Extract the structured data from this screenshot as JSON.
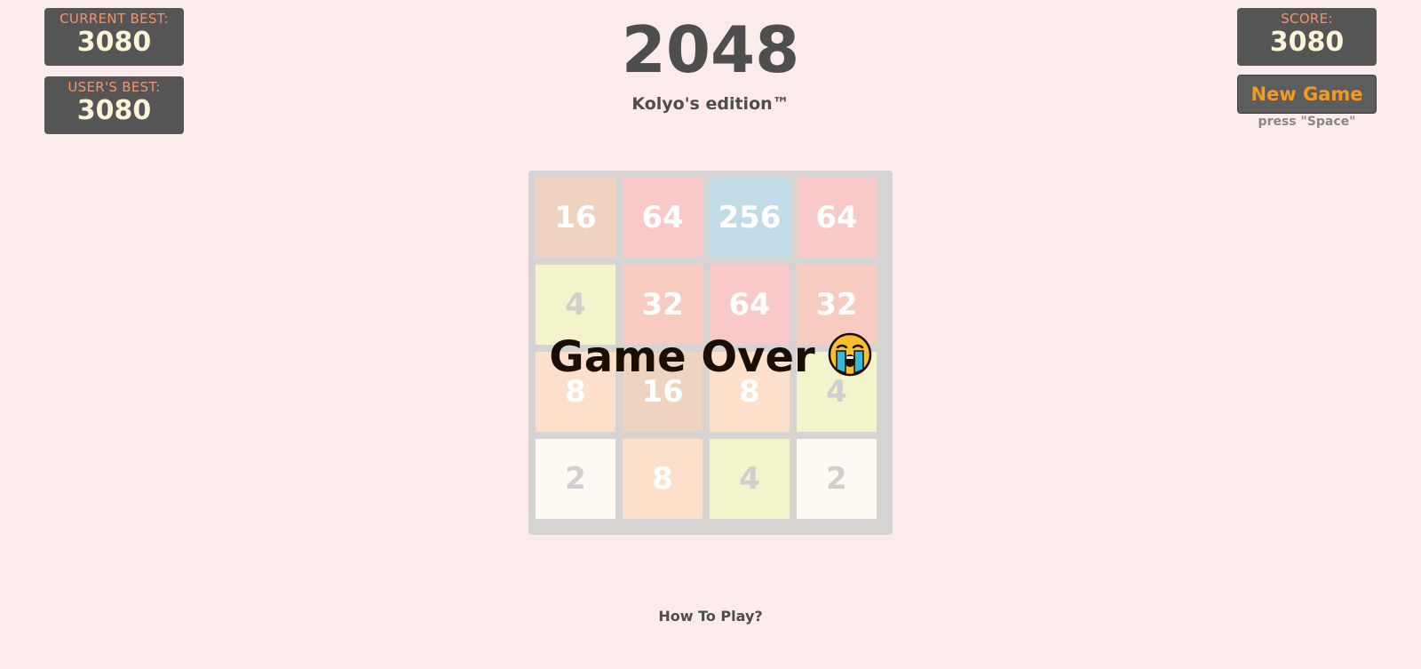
{
  "stats": {
    "current_best": {
      "label": "CURRENT BEST:",
      "value": "3080"
    },
    "users_best": {
      "label": "USER'S BEST:",
      "value": "3080"
    },
    "score": {
      "label": "SCORE:",
      "value": "3080"
    }
  },
  "header": {
    "title": "2048",
    "subtitle": "Kolyo's edition™"
  },
  "controls": {
    "new_game_label": "New Game",
    "hint": "press \"Space\""
  },
  "board": {
    "size": 4,
    "tiles": [
      [
        16,
        64,
        256,
        64
      ],
      [
        4,
        32,
        64,
        32
      ],
      [
        8,
        16,
        8,
        4
      ],
      [
        2,
        8,
        4,
        2
      ]
    ],
    "tile_colors": {
      "2": {
        "bg": "#fff9f4",
        "fg": "#cfcfcf"
      },
      "4": {
        "bg": "#f3f4cb",
        "fg": "#cfcfcf"
      },
      "8": {
        "bg": "#fce0cc",
        "fg": "#ffffff"
      },
      "16": {
        "bg": "#eed3c0",
        "fg": "#ffffff"
      },
      "32": {
        "bg": "#f7cbbf",
        "fg": "#ffffff"
      },
      "64": {
        "bg": "#f9c8c8",
        "fg": "#ffffff"
      },
      "256": {
        "bg": "#c2dbe8",
        "fg": "#ffffff"
      }
    }
  },
  "overlay": {
    "message": "Game Over",
    "emoji_icon": "loudly-crying-face-icon"
  },
  "footer": {
    "how_to_play": "How To Play?"
  }
}
